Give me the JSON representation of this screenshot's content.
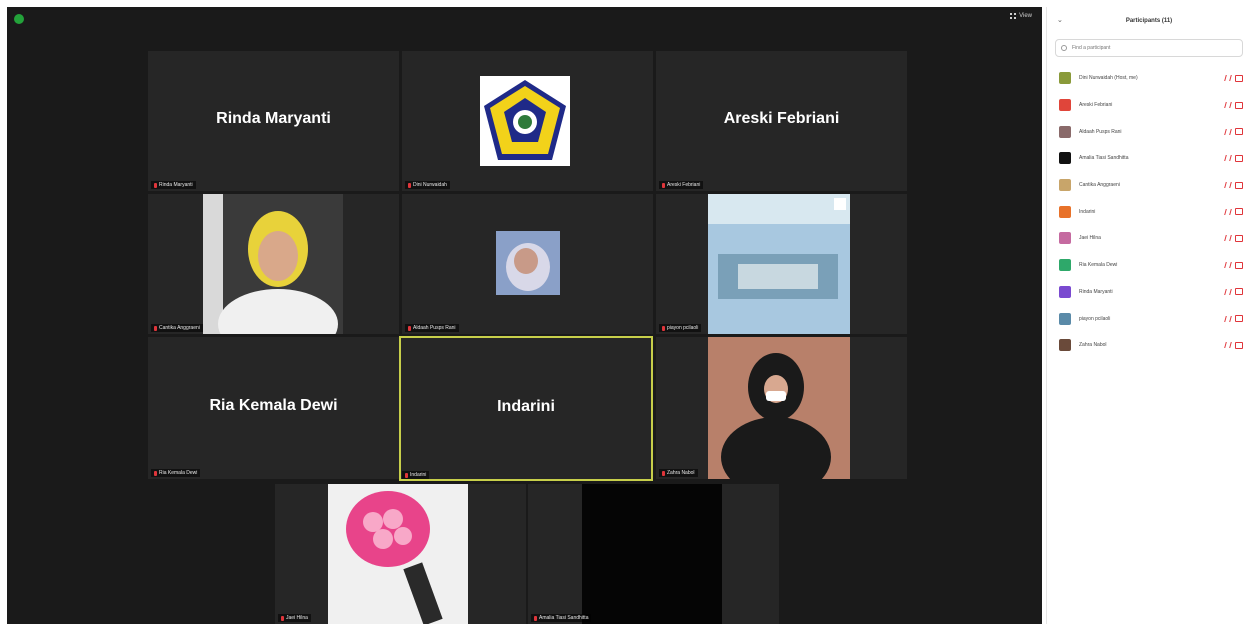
{
  "view_label": "View",
  "panel": {
    "title": "Participants (11)",
    "search_placeholder": "Find a participant"
  },
  "tiles": [
    {
      "name": "Rinda Maryanti",
      "label": "Rinda Maryanti"
    },
    {
      "name": "",
      "label": "Dini Nurwaidah"
    },
    {
      "name": "Areski Febriani",
      "label": "Areski Febriani"
    },
    {
      "name": "",
      "label": "Cantika Anggraeni"
    },
    {
      "name": "",
      "label": "Aldaah Pusps Rani"
    },
    {
      "name": "",
      "label": "piayon pcilaoli"
    },
    {
      "name": "Ria Kemala Dewi",
      "label": "Ria Kemala Dewi"
    },
    {
      "name": "Indarini",
      "label": "Indarini"
    },
    {
      "name": "",
      "label": "Zahra Nabol"
    },
    {
      "name": "",
      "label": "Jaei Hilna"
    },
    {
      "name": "",
      "label": "Amalia Tiasi Sandhitta"
    }
  ],
  "participants": [
    {
      "name": "Dini Nurwaidah (Host, me)",
      "color": "#8a9a3a"
    },
    {
      "name": "Areski Febriani",
      "color": "#e0453a"
    },
    {
      "name": "Aldaah Pusps Rani",
      "color": "#8a6a6a"
    },
    {
      "name": "Amalia Tiasi Sandhitta",
      "color": "#111111"
    },
    {
      "name": "Cantika Anggraeni",
      "color": "#c8a56a"
    },
    {
      "name": "Indarini",
      "color": "#e8722a"
    },
    {
      "name": "Jaei Hilna",
      "color": "#c56aa0"
    },
    {
      "name": "Ria Kemala Dewi",
      "color": "#2ea86a"
    },
    {
      "name": "Rinda Maryanti",
      "color": "#7a4ad0"
    },
    {
      "name": "piayon pcilaoli",
      "color": "#5a8aa8"
    },
    {
      "name": "Zahra Nabol",
      "color": "#6a4a3a"
    }
  ]
}
